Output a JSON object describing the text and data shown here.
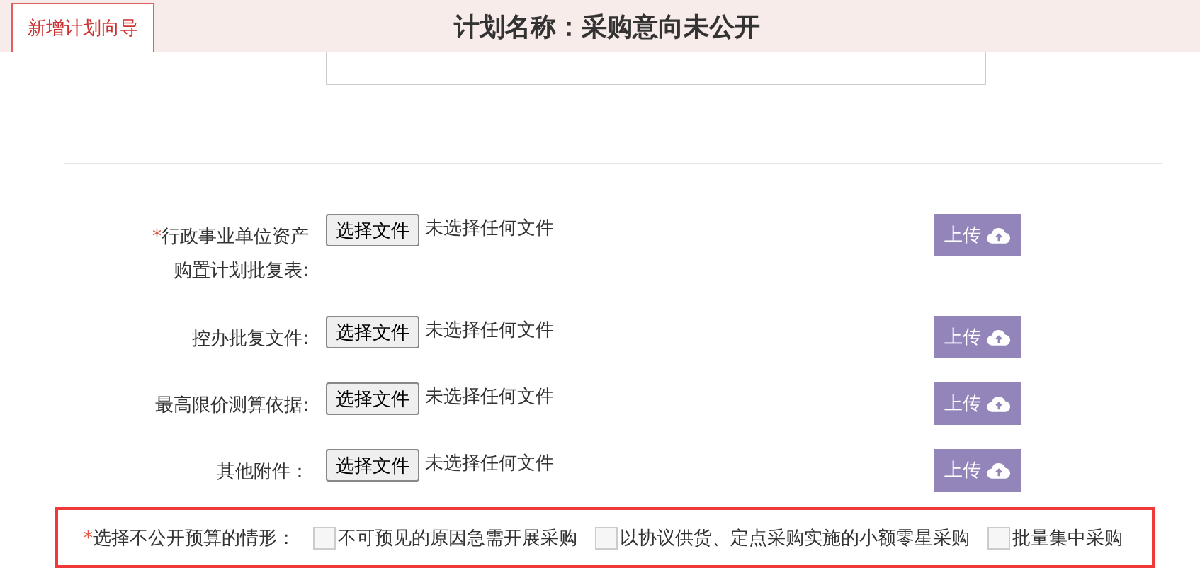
{
  "tab": {
    "label": "新增计划向导",
    "selected": true
  },
  "title": "计划名称：采购意向未公开",
  "files": [
    {
      "label_lines": [
        "行政事业单位资产",
        "购置计划批复表:"
      ],
      "required_mark": "*",
      "choose": "选择文件",
      "status": "未选择任何文件",
      "upload": "上传"
    },
    {
      "label_lines": [
        "控办批复文件:"
      ],
      "choose": "选择文件",
      "status": "未选择任何文件",
      "upload": "上传"
    },
    {
      "label_lines": [
        "最高限价测算依据:"
      ],
      "choose": "选择文件",
      "status": "未选择任何文件",
      "upload": "上传"
    },
    {
      "label_lines": [
        "其他附件："
      ],
      "choose": "选择文件",
      "status": "未选择任何文件",
      "upload": "上传"
    }
  ],
  "reason": {
    "label": "选择不公开预算的情形：",
    "required_mark": "*",
    "options": [
      {
        "label": "不可预见的原因急需开展采购",
        "checked": false
      },
      {
        "label": "以协议供货、定点采购实施的小额零星采购",
        "checked": false
      },
      {
        "label": "批量集中采购",
        "checked": false
      }
    ]
  }
}
